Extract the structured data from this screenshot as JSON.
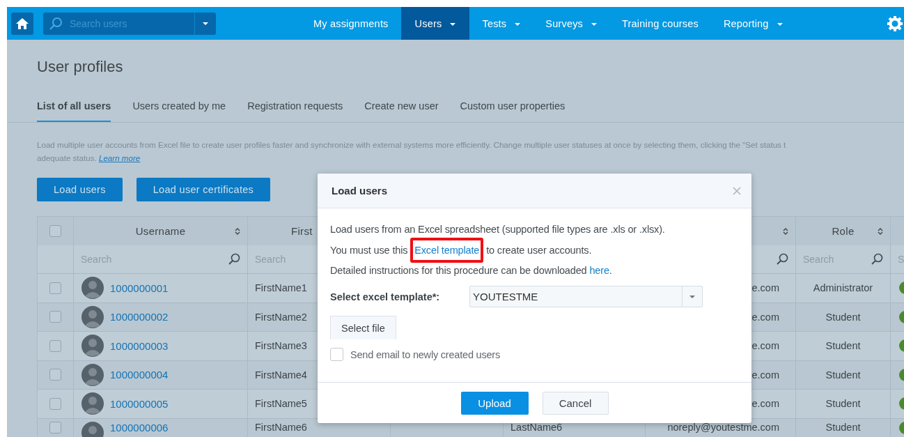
{
  "nav": {
    "search_placeholder": "Search users",
    "items": [
      {
        "label": "My assignments",
        "selected": false,
        "dropdown": false
      },
      {
        "label": "Users",
        "selected": true,
        "dropdown": true
      },
      {
        "label": "Tests",
        "selected": false,
        "dropdown": true
      },
      {
        "label": "Surveys",
        "selected": false,
        "dropdown": true
      },
      {
        "label": "Training courses",
        "selected": false,
        "dropdown": false
      },
      {
        "label": "Reporting",
        "selected": false,
        "dropdown": true
      }
    ]
  },
  "page_title": "User profiles",
  "tabs": [
    {
      "label": "List of all users",
      "selected": true
    },
    {
      "label": "Users created by me",
      "selected": false
    },
    {
      "label": "Registration requests",
      "selected": false
    },
    {
      "label": "Create new user",
      "selected": false
    },
    {
      "label": "Custom user properties",
      "selected": false
    }
  ],
  "info": {
    "line_1": "Load multiple user accounts from Excel file to create user profiles faster and synchronize with external systems more efficiently. Change multiple user statuses at once by selecting them, clicking the \"Set status t",
    "line_2": "adequate status.",
    "link": "Learn more"
  },
  "buttons": [
    "Load users",
    "Load user certificates"
  ],
  "table": {
    "select_all_checked": false,
    "columns": [
      {
        "label": "Username",
        "sortable": true,
        "search": "Search",
        "search_icon": true
      },
      {
        "label": "First",
        "search": "Search"
      },
      {},
      {},
      {
        "sortable": true,
        "search_icon": true
      },
      {
        "label": "Role",
        "sortable": true,
        "search": "Search",
        "search_icon": true
      },
      {
        "search": "S"
      }
    ],
    "rows": [
      {
        "checked": false,
        "username": "1000000001",
        "first_name": "FirstName1",
        "column_6": "e.com",
        "role": "Administrator"
      },
      {
        "checked": false,
        "username": "1000000002",
        "first_name": "FirstName2",
        "column_6": "e.com",
        "role": "Student"
      },
      {
        "checked": false,
        "username": "1000000003",
        "first_name": "FirstName3",
        "column_6": "e.com",
        "role": "Student"
      },
      {
        "checked": false,
        "username": "1000000004",
        "first_name": "FirstName4",
        "column_6": "e.com",
        "role": "Student"
      },
      {
        "checked": false,
        "username": "1000000005",
        "first_name": "FirstName5",
        "column_6": "e.com",
        "role": "Student"
      },
      {
        "checked": false,
        "username": "1000000006",
        "first_name": "FirstName6",
        "column_5": "LastName6",
        "column_6": "noreply@youtestme.com",
        "role": "Student"
      }
    ]
  },
  "dialog": {
    "title": "Load users",
    "line_1": "Load users from an Excel spreadsheet (supported file types are .xls or .xlsx).",
    "line_2": {
      "before": "You must use this ",
      "link": "Excel template",
      "after": " to create user accounts.",
      "highlighted": true
    },
    "line_3": {
      "before": "Detailed instructions for this procedure can be downloaded ",
      "link": "here",
      "after": "."
    },
    "template_label": "Select excel template*:",
    "template_value": "YOUTESTME",
    "select_file": "Select file",
    "send_email": {
      "label": "Send email to newly created users",
      "checked": false
    },
    "buttons": [
      "Upload",
      "Cancel"
    ]
  }
}
